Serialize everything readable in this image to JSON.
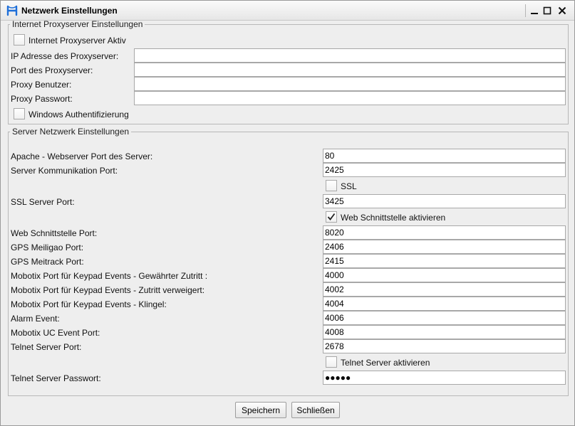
{
  "window": {
    "title": "Netzwerk Einstellungen"
  },
  "proxy": {
    "legend": "Internet Proxyserver Einstellungen",
    "active_label": "Internet Proxyserver Aktiv",
    "active_checked": false,
    "ip_label": "IP Adresse des Proxyserver:",
    "ip_value": "",
    "port_label": "Port des Proxyserver:",
    "port_value": "",
    "user_label": "Proxy Benutzer:",
    "user_value": "",
    "password_label": "Proxy Passwort:",
    "password_value": "",
    "windows_auth_label": "Windows Authentifizierung",
    "windows_auth_checked": false
  },
  "server": {
    "legend": "Server Netzwerk Einstellungen",
    "apache_label": "Apache - Webserver Port des Server:",
    "apache_value": "80",
    "comm_label": "Server Kommunikation Port:",
    "comm_value": "2425",
    "ssl_label": "SSL",
    "ssl_checked": false,
    "ssl_port_label": "SSL Server Port:",
    "ssl_port_value": "3425",
    "web_enable_label": "Web Schnittstelle aktivieren",
    "web_enable_checked": true,
    "web_port_label": "Web Schnittstelle Port:",
    "web_port_value": "8020",
    "gps_meiligao_label": "GPS Meiligao Port:",
    "gps_meiligao_value": "2406",
    "gps_meitrack_label": "GPS Meitrack Port:",
    "gps_meitrack_value": "2415",
    "mobotix_granted_label": "Mobotix Port für Keypad Events - Gewährter Zutritt :",
    "mobotix_granted_value": "4000",
    "mobotix_denied_label": "Mobotix Port für Keypad Events - Zutritt verweigert:",
    "mobotix_denied_value": "4002",
    "mobotix_bell_label": "Mobotix Port für Keypad Events - Klingel:",
    "mobotix_bell_value": "4004",
    "alarm_label": "Alarm Event:",
    "alarm_value": "4006",
    "mobotix_uc_label": "Mobotix UC Event Port:",
    "mobotix_uc_value": "4008",
    "telnet_port_label": "Telnet Server Port:",
    "telnet_port_value": "2678",
    "telnet_enable_label": "Telnet Server aktivieren",
    "telnet_enable_checked": false,
    "telnet_password_label": "Telnet Server Passwort:",
    "telnet_password_value": "●●●●●"
  },
  "buttons": {
    "save": "Speichern",
    "close": "Schließen"
  }
}
